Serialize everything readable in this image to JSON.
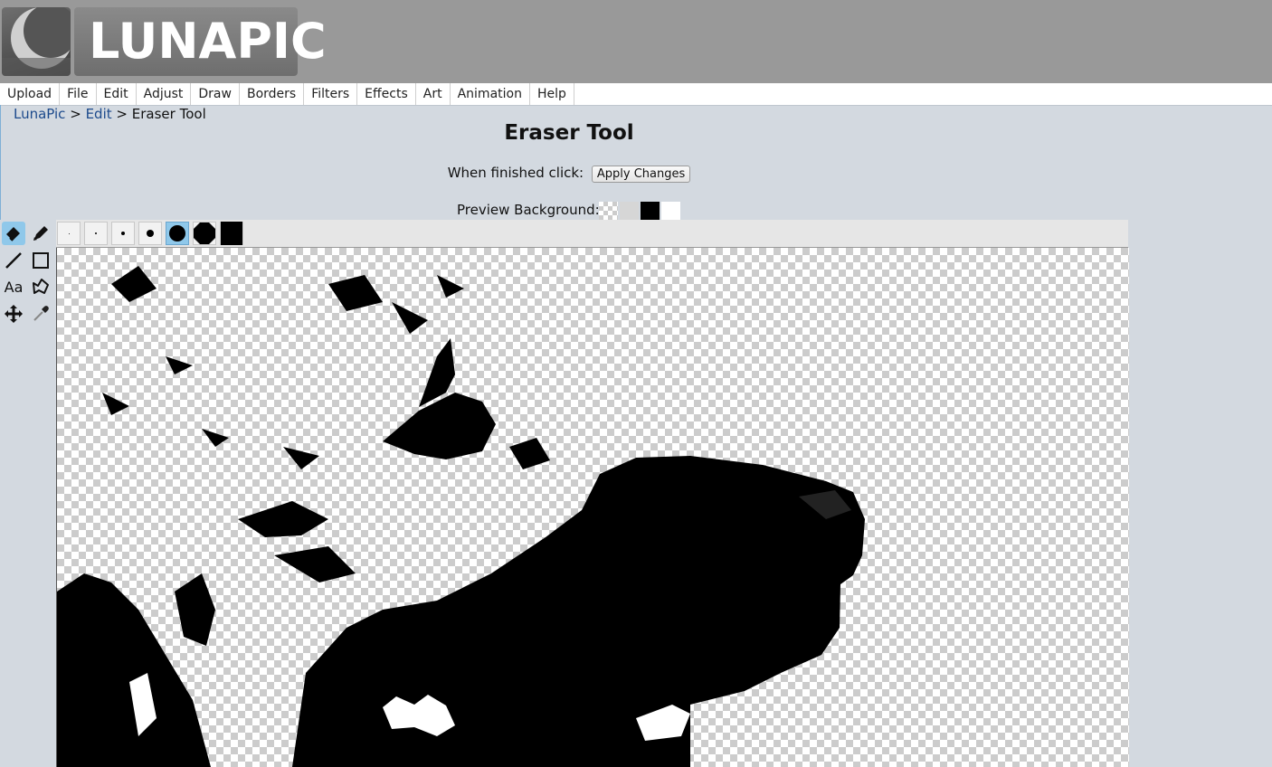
{
  "app": {
    "logo_text": "LUNAPIC"
  },
  "menu": [
    "Upload",
    "File",
    "Edit",
    "Adjust",
    "Draw",
    "Borders",
    "Filters",
    "Effects",
    "Art",
    "Animation",
    "Help"
  ],
  "breadcrumb": {
    "home": "LunaPic",
    "sep1": ">",
    "section": "Edit",
    "sep2": ">",
    "current": "Eraser Tool"
  },
  "page": {
    "title": "Eraser Tool",
    "finish_label": "When finished click:",
    "apply_button": "Apply Changes",
    "preview_label": "Preview Background:"
  },
  "preview_backgrounds": [
    "transparent-checker",
    "gray",
    "black",
    "white"
  ],
  "tools": [
    "eraser-icon",
    "pencil-icon",
    "line-icon",
    "rectangle-icon",
    "text-icon",
    "lasso-icon",
    "move-icon",
    "eyedropper-icon"
  ],
  "tool_text": {
    "text": "Aa"
  },
  "active_tool": "eraser",
  "brush_sizes": [
    "1",
    "2",
    "4",
    "8",
    "16",
    "24",
    "28"
  ],
  "active_brush_size": "16",
  "colors": {
    "accent": "#8fc8ea",
    "header": "#999999",
    "page_bg": "#d3d9e0",
    "link": "#1c4a8c"
  }
}
